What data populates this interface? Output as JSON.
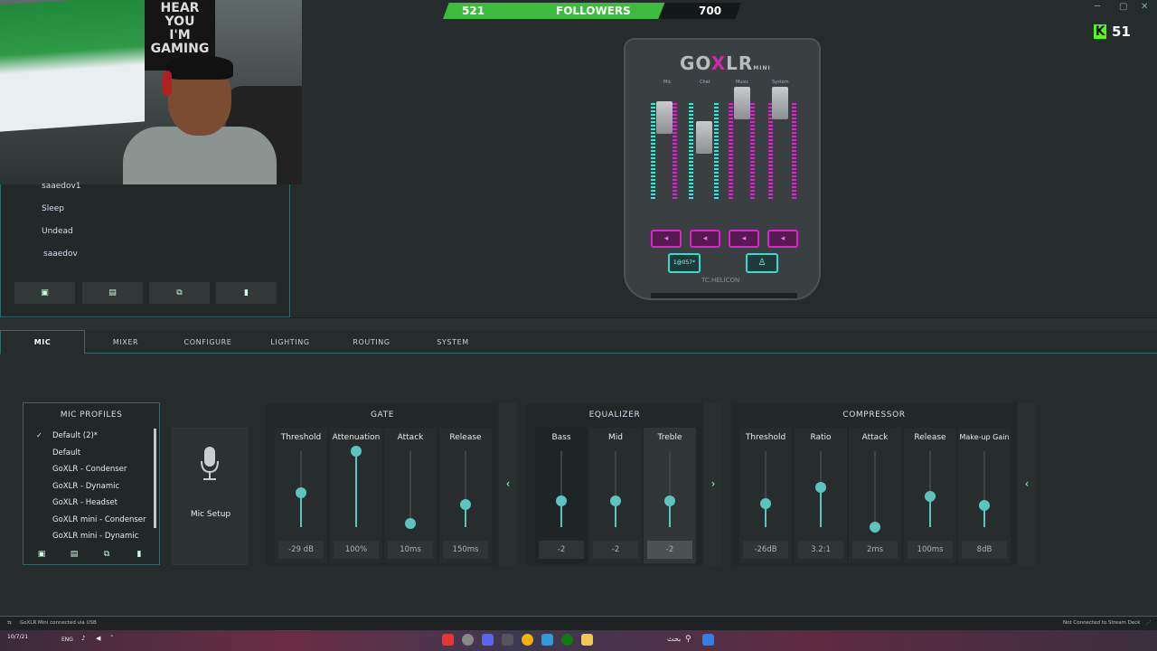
{
  "poster_text": [
    "HEAR",
    "YOU",
    "I'M",
    "GAMING"
  ],
  "followers": {
    "current": "521",
    "label": "FOLLOWERS",
    "goal": "700",
    "fill_fraction": 0.744
  },
  "kick": {
    "count": "51"
  },
  "left_panel": {
    "items": [
      "saaedov1",
      "Sleep",
      "Undead",
      "saaedov"
    ],
    "buttons": [
      "save-icon",
      "file-icon",
      "copy-icon",
      "trash-icon"
    ]
  },
  "device": {
    "logo_go": "GO",
    "logo_x": "X",
    "logo_lr": "LR",
    "logo_mini": "MINI",
    "faders": [
      "Mic",
      "Chat",
      "Music",
      "System"
    ],
    "fx_left": "1@057*",
    "brand": "TC.HELICON"
  },
  "tabs": [
    "MIC",
    "MIXER",
    "CONFIGURE",
    "LIGHTING",
    "ROUTING",
    "SYSTEM"
  ],
  "active_tab": "MIC",
  "mic_profiles": {
    "title": "MIC PROFILES",
    "items": [
      "Default (2)*",
      "Default",
      "GoXLR - Condenser",
      "GoXLR - Dynamic",
      "GoXLR - Headset",
      "GoXLR mini - Condenser",
      "GoXLR mini - Dynamic"
    ],
    "selected_index": 0
  },
  "mic_setup": {
    "label": "Mic Setup"
  },
  "gate": {
    "title": "GATE",
    "columns": [
      {
        "label": "Threshold",
        "value": "-29 dB",
        "level": 0.45
      },
      {
        "label": "Attenuation",
        "value": "100%",
        "level": 1.0
      },
      {
        "label": "Attack",
        "value": "10ms",
        "level": 0.05
      },
      {
        "label": "Release",
        "value": "150ms",
        "level": 0.3
      }
    ]
  },
  "equalizer": {
    "title": "EQUALIZER",
    "columns": [
      {
        "label": "Bass",
        "value": "-2",
        "level": 0.35
      },
      {
        "label": "Mid",
        "value": "-2",
        "level": 0.35
      },
      {
        "label": "Treble",
        "value": "-2",
        "level": 0.35
      }
    ]
  },
  "compressor": {
    "title": "COMPRESSOR",
    "columns": [
      {
        "label": "Threshold",
        "value": "-26dB",
        "level": 0.31
      },
      {
        "label": "Ratio",
        "value": "3.2:1",
        "level": 0.52
      },
      {
        "label": "Attack",
        "value": "2ms",
        "level": 0.0
      },
      {
        "label": "Release",
        "value": "100ms",
        "level": 0.41
      },
      {
        "label": "Make-up Gain",
        "value": "8dB",
        "level": 0.29
      }
    ]
  },
  "status": {
    "left": "GoXLR Mini connected via USB",
    "right": "Not Connected to Stream Deck"
  },
  "taskbar": {
    "lang": "ENG",
    "date": "10/7/21",
    "ar_text": "بحث"
  }
}
